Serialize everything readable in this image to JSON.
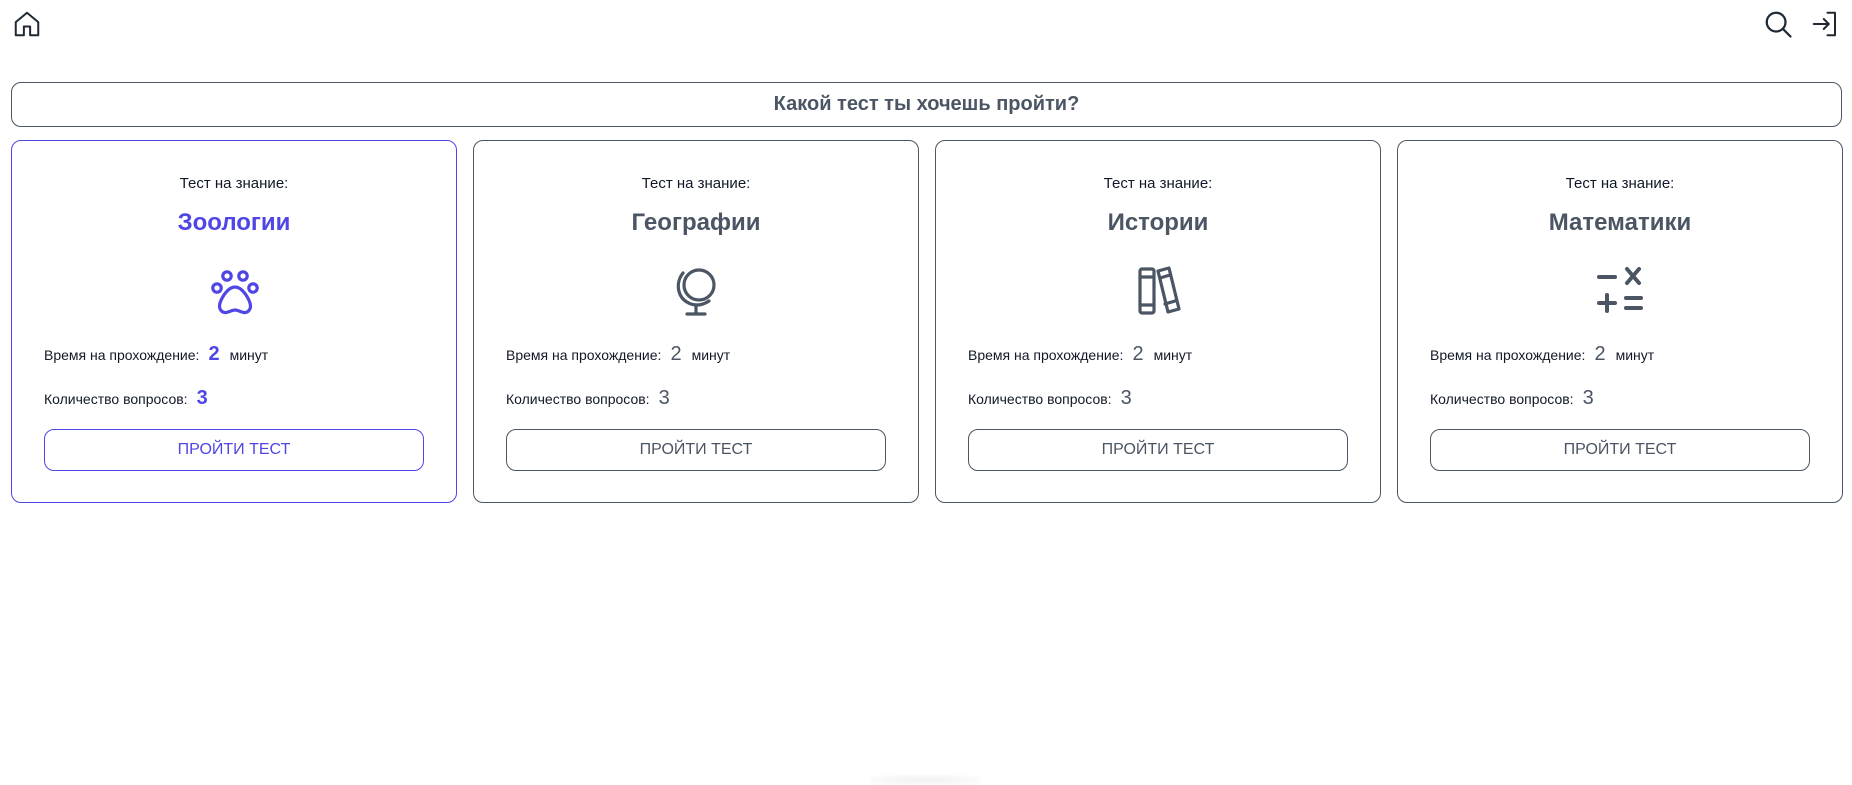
{
  "header": {
    "home_icon": "home-icon",
    "search_icon": "search-icon",
    "login_icon": "login-icon"
  },
  "question": "Какой тест ты хочешь пройти?",
  "colors": {
    "accent": "#4f46e5",
    "neutral": "#4b5563"
  },
  "cards": [
    {
      "prefix": "Тест на знание:",
      "subject": "Зоологии",
      "icon": "paw-icon",
      "time_label": "Время на прохождение:",
      "time_value": "2",
      "time_unit": "минут",
      "count_label": "Количество вопросов:",
      "count_value": "3",
      "button": "ПРОЙТИ ТЕСТ",
      "active": true
    },
    {
      "prefix": "Тест на знание:",
      "subject": "Географии",
      "icon": "globe-icon",
      "time_label": "Время на прохождение:",
      "time_value": "2",
      "time_unit": "минут",
      "count_label": "Количество вопросов:",
      "count_value": "3",
      "button": "ПРОЙТИ ТЕСТ",
      "active": false
    },
    {
      "prefix": "Тест на знание:",
      "subject": "Истории",
      "icon": "books-icon",
      "time_label": "Время на прохождение:",
      "time_value": "2",
      "time_unit": "минут",
      "count_label": "Количество вопросов:",
      "count_value": "3",
      "button": "ПРОЙТИ ТЕСТ",
      "active": false
    },
    {
      "prefix": "Тест на знание:",
      "subject": "Математики",
      "icon": "math-operators-icon",
      "time_label": "Время на прохождение:",
      "time_value": "2",
      "time_unit": "минут",
      "count_label": "Количество вопросов:",
      "count_value": "3",
      "button": "ПРОЙТИ ТЕСТ",
      "active": false
    }
  ]
}
